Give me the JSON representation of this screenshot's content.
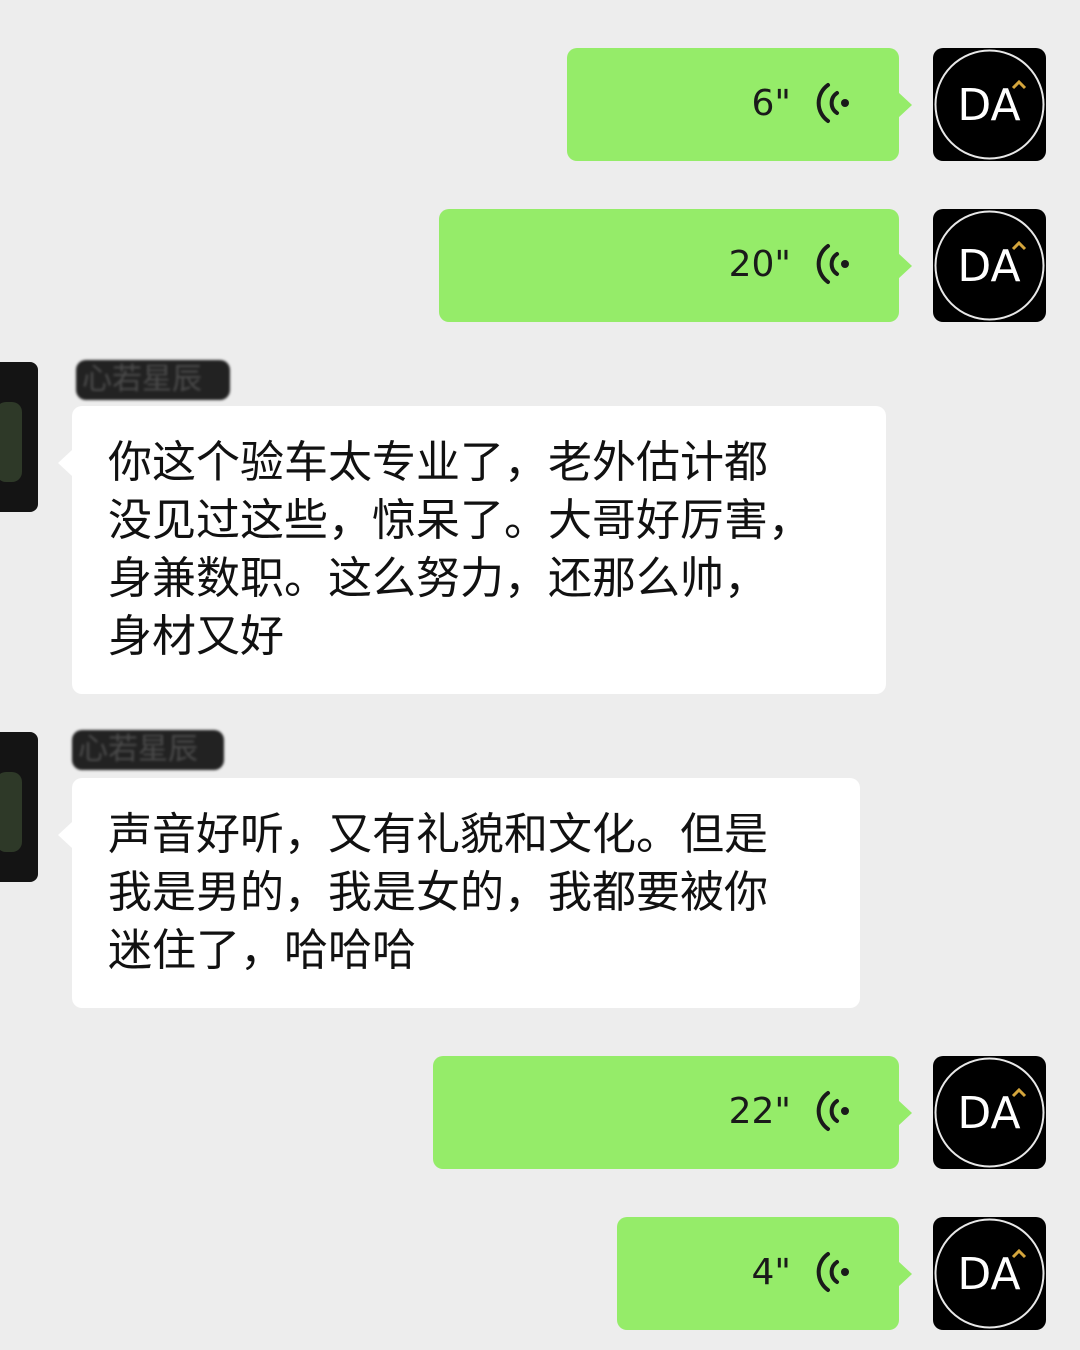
{
  "theme": {
    "self_bubble_color": "#95ec69",
    "other_bubble_color": "#ffffff",
    "background": "#ededed"
  },
  "self": {
    "avatar_text": "DA"
  },
  "messages": {
    "m1": {
      "duration": "6\"",
      "icon": "voice-wave-icon"
    },
    "m2": {
      "duration": "20\"",
      "icon": "voice-wave-icon"
    },
    "m3": {
      "sender": "心若星辰",
      "lines": [
        "你这个验车太专业了，老外估计都",
        "没见过这些，惊呆了。大哥好厉害，",
        "身兼数职。这么努力，还那么帅，",
        "身材又好"
      ]
    },
    "m4": {
      "sender": "心若星辰",
      "lines": [
        "声音好听，又有礼貌和文化。但是",
        "我是男的，我是女的，我都要被你",
        "迷住了，哈哈哈"
      ]
    },
    "m5": {
      "duration": "22\"",
      "icon": "voice-wave-icon"
    },
    "m6": {
      "duration": "4\"",
      "icon": "voice-wave-icon"
    }
  }
}
